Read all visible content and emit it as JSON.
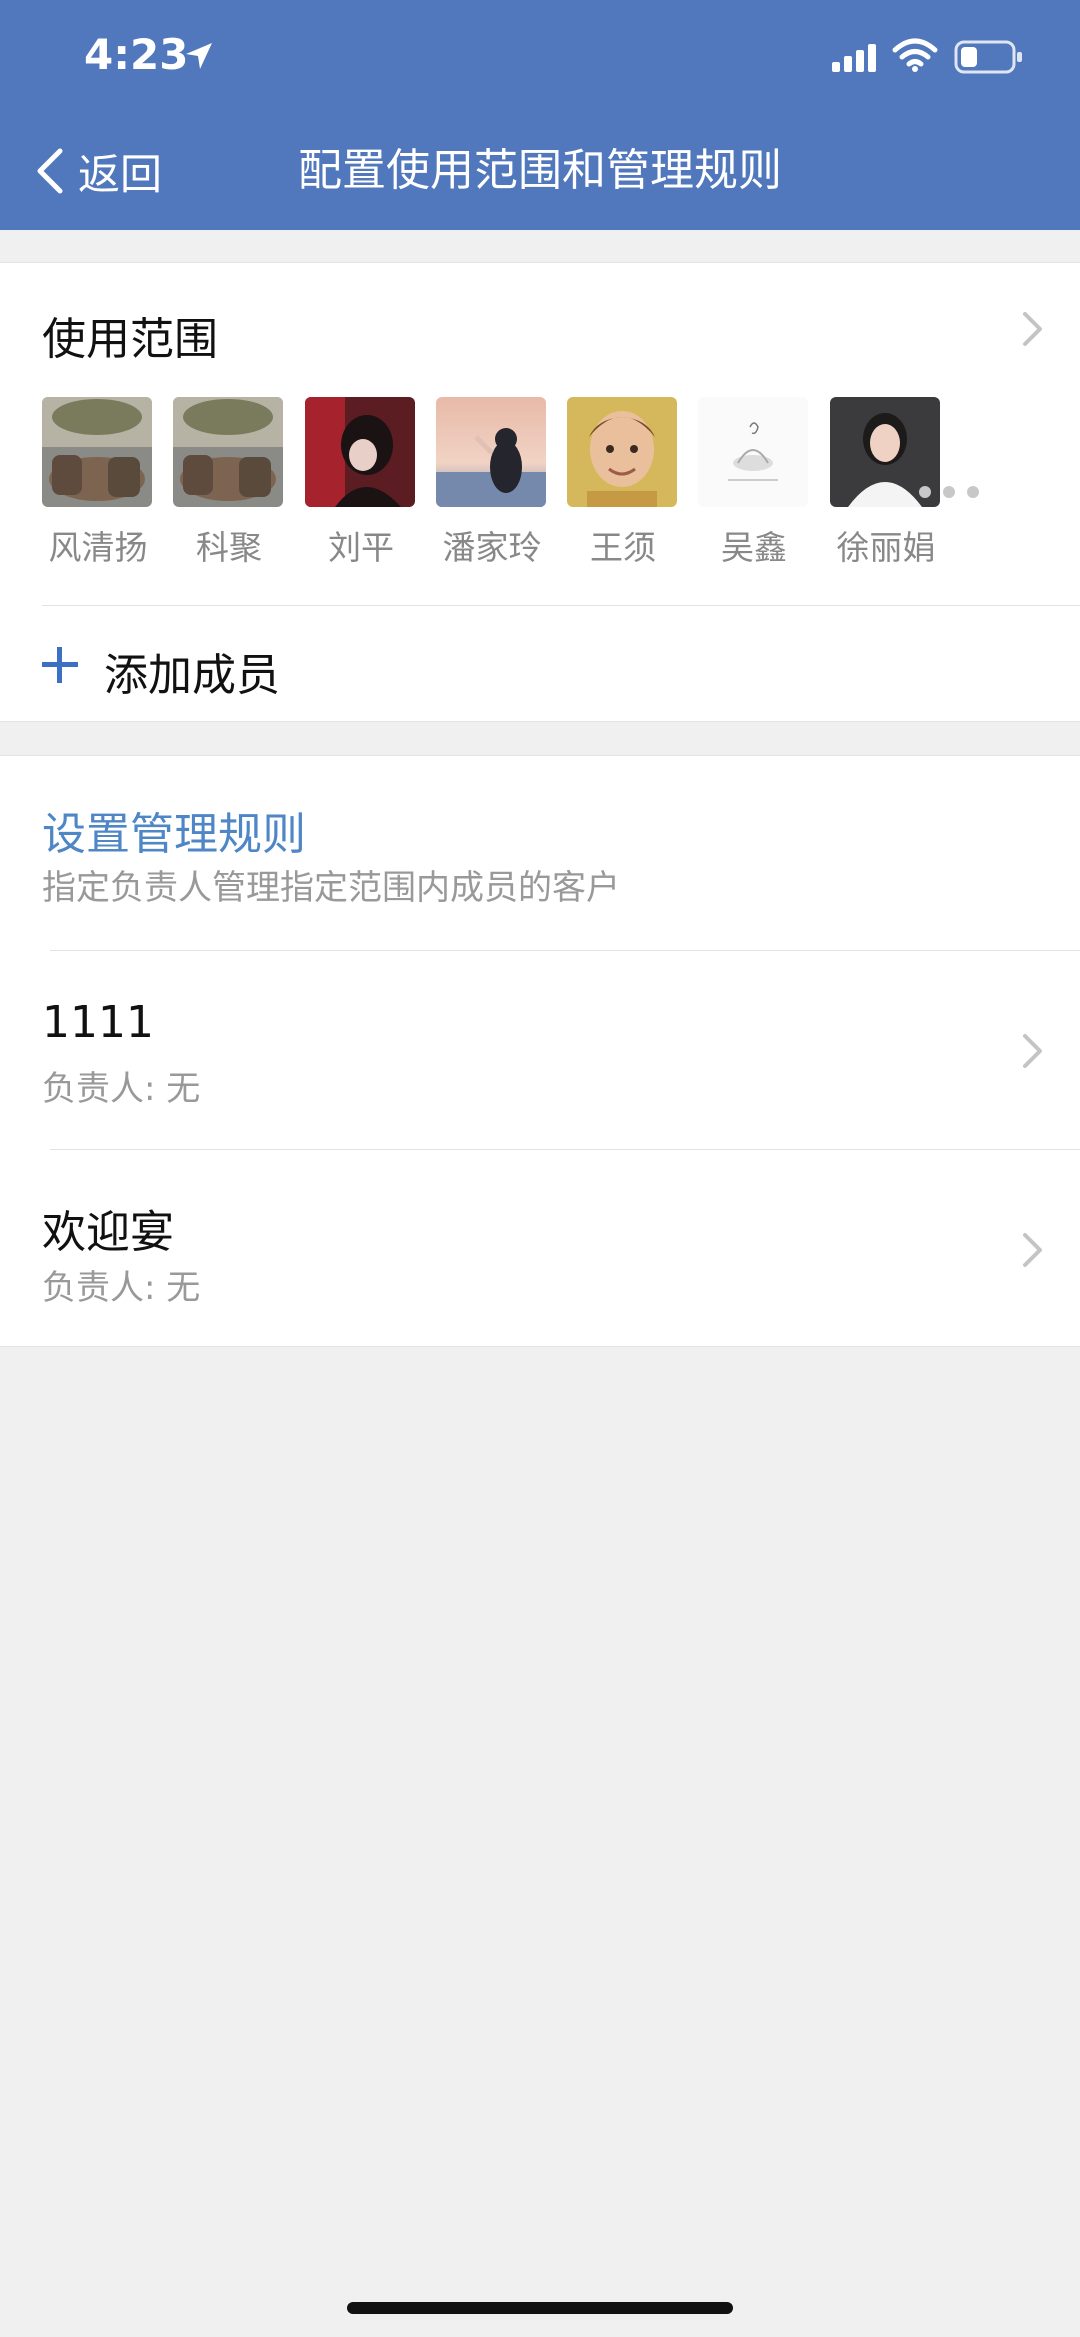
{
  "status_bar": {
    "time": "4:23",
    "icons": [
      "location-arrow-icon",
      "signal-icon",
      "wifi-icon",
      "battery-icon"
    ]
  },
  "nav": {
    "back_label": "返回",
    "title": "配置使用范围和管理规则",
    "bg_color": "#5177bc"
  },
  "usage_scope": {
    "title": "使用范围",
    "members": [
      {
        "name": "风清扬",
        "avatar": "outdoor-chairs-photo"
      },
      {
        "name": "科聚",
        "avatar": "outdoor-chairs-photo"
      },
      {
        "name": "刘平",
        "avatar": "woman-portrait-red-photo"
      },
      {
        "name": "潘家玲",
        "avatar": "sunset-heart-photo"
      },
      {
        "name": "王须",
        "avatar": "boy-portrait-photo"
      },
      {
        "name": "吴鑫",
        "avatar": "white-sketch-photo"
      },
      {
        "name": "徐丽娟",
        "avatar": "woman-white-suit-photo"
      }
    ],
    "add_member_label": "添加成员"
  },
  "rules": {
    "title": "设置管理规则",
    "subtitle": "指定负责人管理指定范围内成员的客户",
    "title_color": "#4f86c6",
    "items": [
      {
        "name": "1111",
        "owner": "负责人: 无"
      },
      {
        "name": "欢迎宴",
        "owner": "负责人: 无"
      }
    ]
  }
}
